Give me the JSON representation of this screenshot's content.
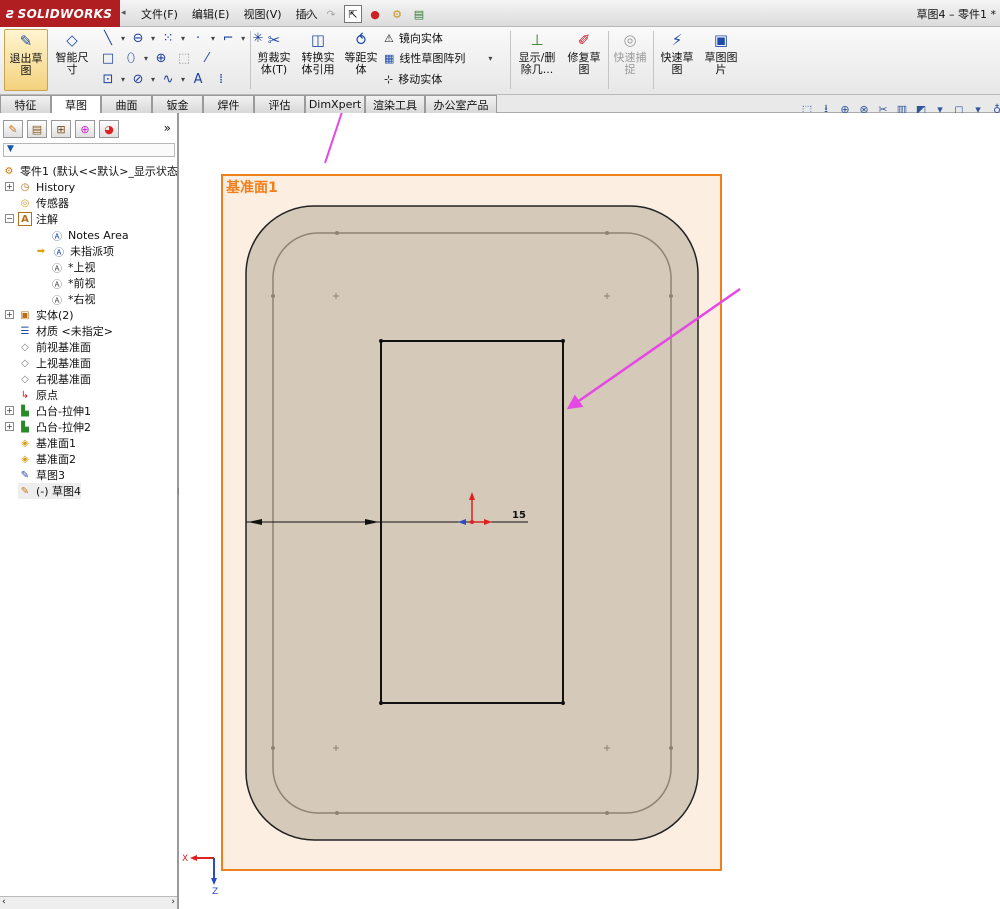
{
  "app": {
    "logo": "SOLIDWORKS",
    "doc_title": "草图4 – 零件1 *"
  },
  "menu": [
    "文件(F)",
    "编辑(E)",
    "视图(V)",
    "插入"
  ],
  "commands": {
    "exit_sketch": "退出草图",
    "smart_dim": "智能尺寸",
    "trim": "剪裁实体(T)",
    "convert": "转换实体引用",
    "offset": "等距实体",
    "mirror": "镜向实体",
    "linear_pattern": "线性草图阵列",
    "move": "移动实体",
    "show_delete": "显示/删除几...",
    "repair": "修复草图",
    "quick_snap": "快速捕捉",
    "rapid_sketch": "快速草图",
    "sketch_picture": "草图图片"
  },
  "tabs": [
    "特征",
    "草图",
    "曲面",
    "钣金",
    "焊件",
    "评估",
    "DimXpert",
    "渲染工具",
    "办公室产品"
  ],
  "active_tab": "草图",
  "tree": {
    "root": "零件1 (默认<<默认>_显示状态",
    "history": "History",
    "sensors": "传感器",
    "annotations": "注解",
    "notes_area": "Notes Area",
    "unassigned": "未指派项",
    "top_view": "*上视",
    "front_view": "*前视",
    "right_view": "*右视",
    "solid_bodies": "实体(2)",
    "material": "材质 <未指定>",
    "front_plane": "前视基准面",
    "top_plane": "上视基准面",
    "right_plane": "右视基准面",
    "origin": "原点",
    "boss1": "凸台-拉伸1",
    "boss2": "凸台-拉伸2",
    "plane1": "基准面1",
    "plane2": "基准面2",
    "sketch3": "草图3",
    "sketch4": "(-) 草图4"
  },
  "canvas": {
    "plane_label": "基准面1",
    "dimension_value": "15",
    "axis_x": "X",
    "axis_z": "Z",
    "plane_color": "#f07f1e",
    "body_fill": "#d5c9b9",
    "arrow_color": "#e548e5"
  }
}
